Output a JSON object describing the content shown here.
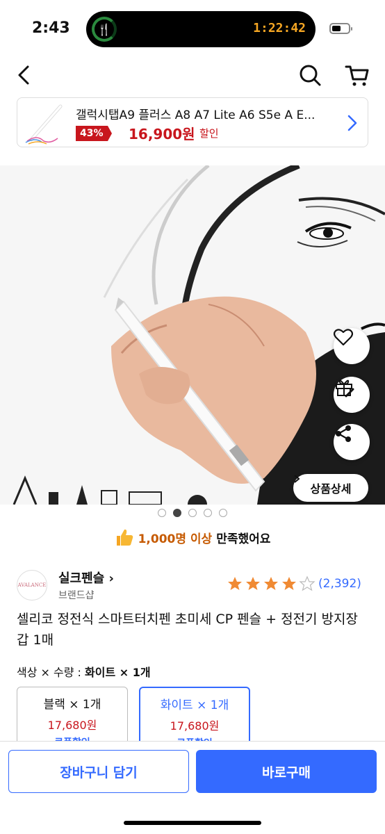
{
  "status_bar": {
    "time": "2:43",
    "island_timer": "1:22:42",
    "island_icon": "fork-knife-icon"
  },
  "nav": {
    "back_icon": "chevron-left-icon",
    "search_icon": "search-icon",
    "cart_icon": "cart-icon"
  },
  "related_product": {
    "name": "갤럭시탭A9 플러스 A8 A7 Lite A6 S5e A E...",
    "discount": "43%",
    "price": "16,900원",
    "tag": "할인"
  },
  "hero": {
    "actions": [
      "heart-icon",
      "gift-icon",
      "share-icon"
    ],
    "detail_button": "상품상세",
    "slide_count": 5,
    "active_slide": 1
  },
  "satisfaction": {
    "count": "1,000명 이상",
    "suffix": "만족했어요"
  },
  "seller": {
    "logo_text": "AVALANCE",
    "name": "실크펜슬",
    "type": "브랜드샵",
    "rating": 4,
    "reviews": "(2,392)"
  },
  "product": {
    "title": "셀리코 정전식 스마트터치펜 초미세 CP 펜슬 + 정전기 방지장갑 1매"
  },
  "option": {
    "label": "색상 × 수량 :",
    "selected_value": "화이트 × 1개",
    "choices": [
      {
        "name": "블랙 × 1개",
        "price": "17,680원",
        "coupon": "쿠폰할인"
      },
      {
        "name": "화이트 × 1개",
        "price": "17,680원",
        "coupon": "쿠폰할인"
      }
    ]
  },
  "actions": {
    "cart": "장바구니 담기",
    "buy": "바로구매"
  },
  "colors": {
    "accent": "#346aff",
    "price_red": "#c8161d",
    "star": "#f08a33"
  }
}
